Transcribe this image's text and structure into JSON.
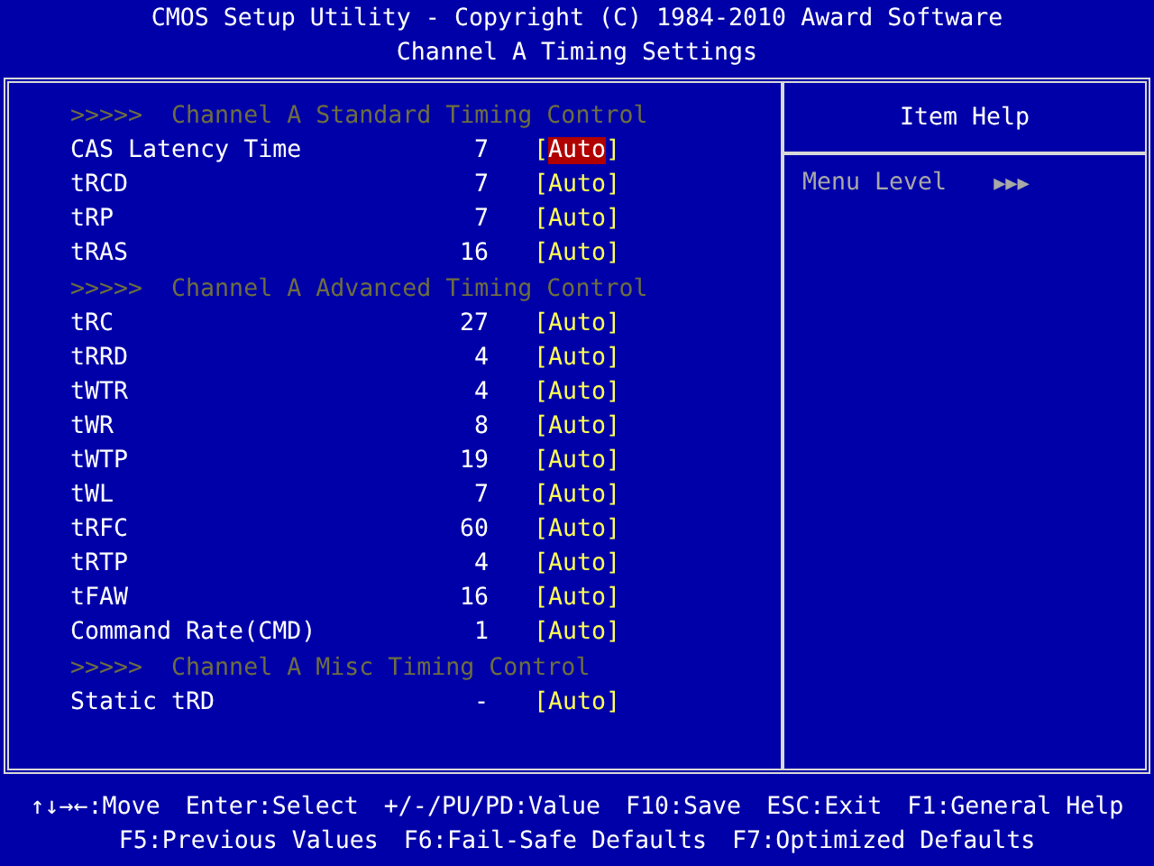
{
  "title": "CMOS Setup Utility - Copyright (C) 1984-2010 Award Software",
  "subtitle": "Channel A Timing Settings",
  "rows": [
    {
      "kind": "header",
      "label": ">>>>>  Channel A Standard Timing Control"
    },
    {
      "kind": "setting",
      "label": "CAS Latency Time",
      "current": "7",
      "value": "[Auto]",
      "selected": true
    },
    {
      "kind": "setting",
      "label": "tRCD",
      "current": "7",
      "value": "[Auto]",
      "selected": false
    },
    {
      "kind": "setting",
      "label": "tRP",
      "current": "7",
      "value": "[Auto]",
      "selected": false
    },
    {
      "kind": "setting",
      "label": "tRAS",
      "current": "16",
      "value": "[Auto]",
      "selected": false
    },
    {
      "kind": "header",
      "label": ">>>>>  Channel A Advanced Timing Control"
    },
    {
      "kind": "setting",
      "label": "tRC",
      "current": "27",
      "value": "[Auto]",
      "selected": false
    },
    {
      "kind": "setting",
      "label": "tRRD",
      "current": "4",
      "value": "[Auto]",
      "selected": false
    },
    {
      "kind": "setting",
      "label": "tWTR",
      "current": "4",
      "value": "[Auto]",
      "selected": false
    },
    {
      "kind": "setting",
      "label": "tWR",
      "current": "8",
      "value": "[Auto]",
      "selected": false
    },
    {
      "kind": "setting",
      "label": "tWTP",
      "current": "19",
      "value": "[Auto]",
      "selected": false
    },
    {
      "kind": "setting",
      "label": "tWL",
      "current": "7",
      "value": "[Auto]",
      "selected": false
    },
    {
      "kind": "setting",
      "label": "tRFC",
      "current": "60",
      "value": "[Auto]",
      "selected": false
    },
    {
      "kind": "setting",
      "label": "tRTP",
      "current": "4",
      "value": "[Auto]",
      "selected": false
    },
    {
      "kind": "setting",
      "label": "tFAW",
      "current": "16",
      "value": "[Auto]",
      "selected": false
    },
    {
      "kind": "setting",
      "label": "Command Rate(CMD)",
      "current": "1",
      "value": "[Auto]",
      "selected": false
    },
    {
      "kind": "header",
      "label": ">>>>>  Channel A Misc Timing Control"
    },
    {
      "kind": "setting",
      "label": "Static tRD",
      "current": "-",
      "value": "[Auto]",
      "selected": false
    }
  ],
  "help": {
    "title": "Item Help",
    "menu_level_label": "Menu Level",
    "menu_level_marker": "▶▶▶"
  },
  "footer": [
    [
      "↑↓→←:Move",
      "Enter:Select",
      "+/-/PU/PD:Value",
      "F10:Save",
      "ESC:Exit",
      "F1:General Help"
    ],
    [
      "F5:Previous Values",
      "F6:Fail-Safe Defaults",
      "F7:Optimized Defaults"
    ]
  ]
}
